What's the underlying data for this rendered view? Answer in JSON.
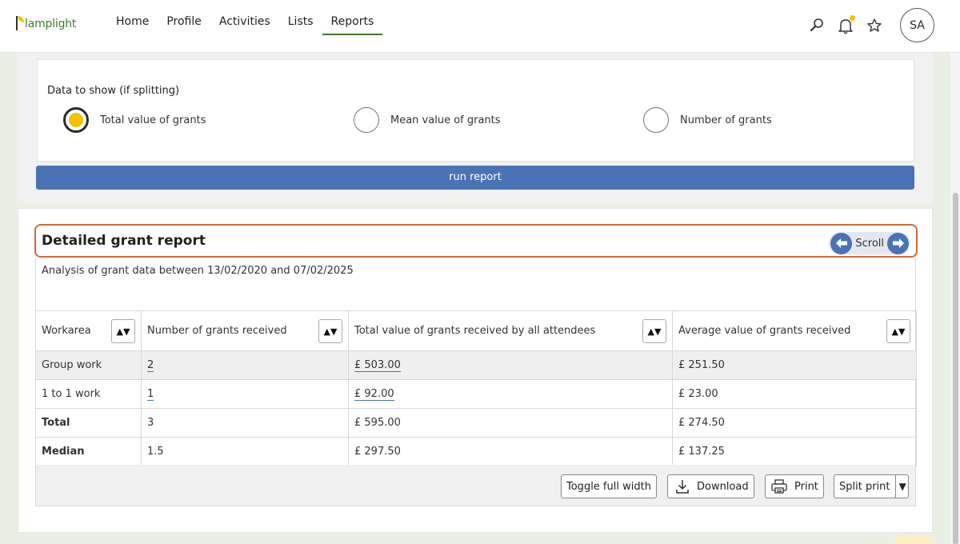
{
  "app": {
    "logo_text": "lamplight"
  },
  "nav": {
    "items": [
      {
        "label": "Home"
      },
      {
        "label": "Profile"
      },
      {
        "label": "Activities"
      },
      {
        "label": "Lists"
      },
      {
        "label": "Reports"
      }
    ],
    "active": "Reports",
    "avatar_initials": "SA"
  },
  "options": {
    "title": "Data to show (if splitting)",
    "radios": [
      {
        "label": "Total value of grants",
        "checked": true
      },
      {
        "label": "Mean value of grants",
        "checked": false
      },
      {
        "label": "Number of grants",
        "checked": false
      }
    ],
    "run_label": "run report"
  },
  "report": {
    "title": "Detailed grant report",
    "scroll_label": "Scroll",
    "description": "Analysis of grant data between 13/02/2020 and 07/02/2025",
    "columns": [
      "Workarea",
      "Number of grants received",
      "Total value of grants received by all attendees",
      "Average value of grants received"
    ],
    "sort_glyph": "▲▼",
    "rows": [
      {
        "workarea": "Group work",
        "count": "2",
        "total": "£ 503.00",
        "average": "£ 251.50"
      },
      {
        "workarea": "1 to 1 work",
        "count": "1",
        "total": "£ 92.00",
        "average": "£ 23.00"
      },
      {
        "workarea": "Total",
        "count": "3",
        "total": "£ 595.00",
        "average": "£ 274.50"
      },
      {
        "workarea": "Median",
        "count": "1.5",
        "total": "£ 297.50",
        "average": "£ 137.25"
      }
    ],
    "buttons": {
      "toggle_width": "Toggle full width",
      "download": "Download",
      "print": "Print",
      "split_print": "Split print",
      "split_arrow": "▼"
    }
  },
  "colors": {
    "accent_green": "#3d7a2a",
    "primary_blue": "#4a73b5",
    "highlight_orange": "#d46a32",
    "radio_yellow": "#f2c300"
  }
}
